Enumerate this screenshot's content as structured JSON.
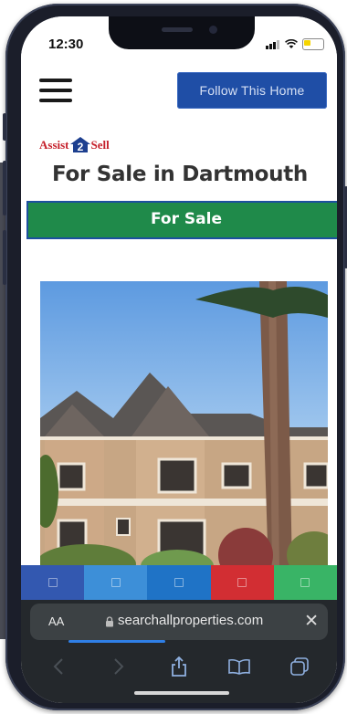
{
  "status_bar": {
    "time": "12:30"
  },
  "header": {
    "follow_button": "Follow This Home"
  },
  "logo": {
    "left": "Assist",
    "mark": "2",
    "right": "Sell"
  },
  "listing": {
    "title": "For Sale in Dartmouth",
    "status": "For Sale"
  },
  "share_strip": {
    "buttons": [
      {
        "color": "#3358b0"
      },
      {
        "color": "#3d8fd8"
      },
      {
        "color": "#1f73c6"
      },
      {
        "color": "#d22e33"
      },
      {
        "color": "#39b466"
      }
    ]
  },
  "browser": {
    "aa_label": "AA",
    "url": "searchallproperties.com",
    "close_label": "✕"
  },
  "colors": {
    "accent_blue": "#1f4ea6",
    "status_green": "#1f8a4a",
    "brand_red": "#c5202b"
  }
}
